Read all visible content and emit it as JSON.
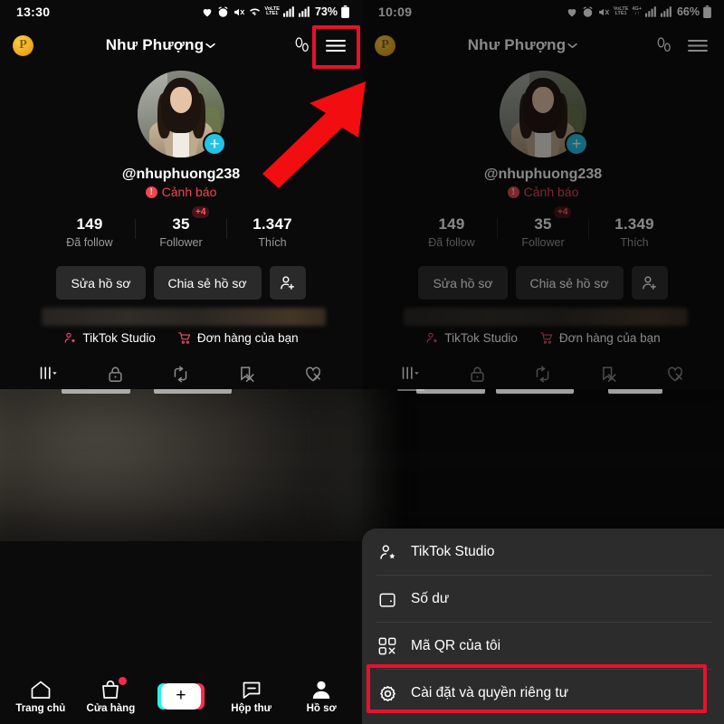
{
  "screens": [
    {
      "id": "left",
      "status_bar": {
        "clock": "13:30",
        "battery_percent": "73%",
        "network_label": "LTE1",
        "network_type": "VoLTE"
      },
      "top_bar": {
        "coin_label": "P",
        "title": "Như Phượng",
        "chevron_icon": "chevron-down-icon",
        "footprint_icon": "footprint-icon",
        "menu_icon": "hamburger-menu-icon"
      },
      "profile": {
        "handle": "@nhuphuong238",
        "warning_label": "Cảnh báo",
        "warning_icon": "exclamation-circle-icon",
        "add_badge_icon": "plus-icon"
      },
      "stats": [
        {
          "value": "149",
          "label": "Đã follow",
          "badge": ""
        },
        {
          "value": "35",
          "label": "Follower",
          "badge": "+4"
        },
        {
          "value": "1.347",
          "label": "Thích",
          "badge": ""
        }
      ],
      "actions": [
        {
          "label": "Sửa hồ sơ",
          "icon": ""
        },
        {
          "label": "Chia sẻ hồ sơ",
          "icon": ""
        },
        {
          "label": "",
          "icon": "add-person-icon"
        }
      ],
      "quick_links": [
        {
          "label": "TikTok Studio",
          "icon": "person-star-icon"
        },
        {
          "label": "Đơn hàng của bạn",
          "icon": "shopping-cart-icon"
        }
      ],
      "tabs": [
        {
          "icon": "grid-posts-icon",
          "active": true
        },
        {
          "icon": "lock-private-icon",
          "active": false
        },
        {
          "icon": "repost-icon",
          "active": false
        },
        {
          "icon": "bookmark-off-icon",
          "active": false
        },
        {
          "icon": "heart-off-icon",
          "active": false
        }
      ]
    },
    {
      "id": "right",
      "status_bar": {
        "clock": "10:09",
        "battery_percent": "66%",
        "network_label": "LTE1",
        "network_type": "VoLTE",
        "network_secondary": "4G+"
      },
      "top_bar": {
        "coin_label": "P",
        "title": "Như Phượng",
        "chevron_icon": "chevron-down-icon",
        "footprint_icon": "footprint-icon",
        "menu_icon": "hamburger-menu-icon"
      },
      "profile": {
        "handle": "@nhuphuong238",
        "warning_label": "Cảnh báo",
        "warning_icon": "exclamation-circle-icon",
        "add_badge_icon": "plus-icon"
      },
      "stats": [
        {
          "value": "149",
          "label": "Đã follow",
          "badge": ""
        },
        {
          "value": "35",
          "label": "Follower",
          "badge": "+4"
        },
        {
          "value": "1.349",
          "label": "Thích",
          "badge": ""
        }
      ],
      "actions": [
        {
          "label": "Sửa hồ sơ",
          "icon": ""
        },
        {
          "label": "Chia sẻ hồ sơ",
          "icon": ""
        },
        {
          "label": "",
          "icon": "add-person-icon"
        }
      ],
      "quick_links": [
        {
          "label": "TikTok Studio",
          "icon": "person-star-icon"
        },
        {
          "label": "Đơn hàng của bạn",
          "icon": "shopping-cart-icon"
        }
      ],
      "tabs": [
        {
          "icon": "grid-posts-icon",
          "active": true
        },
        {
          "icon": "lock-private-icon",
          "active": false
        },
        {
          "icon": "repost-icon",
          "active": false
        },
        {
          "icon": "bookmark-off-icon",
          "active": false
        },
        {
          "icon": "heart-off-icon",
          "active": false
        }
      ]
    }
  ],
  "menu_sheet": {
    "items": [
      {
        "label": "TikTok Studio",
        "icon": "person-star-icon",
        "highlighted": false
      },
      {
        "label": "Số dư",
        "icon": "wallet-icon",
        "highlighted": false
      },
      {
        "label": "Mã QR của tôi",
        "icon": "qr-code-icon",
        "highlighted": false
      },
      {
        "label": "Cài đặt và quyền riêng tư",
        "icon": "gear-icon",
        "highlighted": true
      }
    ]
  },
  "bottom_nav": [
    {
      "label": "Trang chủ",
      "icon": "home-icon",
      "badge": false
    },
    {
      "label": "Cửa hàng",
      "icon": "shop-bag-icon",
      "badge": true
    },
    {
      "label": "",
      "icon": "create-plus-icon",
      "badge": false
    },
    {
      "label": "Hộp thư",
      "icon": "inbox-message-icon",
      "badge": false
    },
    {
      "label": "Hồ sơ",
      "icon": "profile-person-icon",
      "badge": false
    }
  ],
  "annotations": {
    "highlight_color": "#e8112d",
    "arrow": {
      "name": "red-arrow-pointing-to-menu",
      "direction": "up-right"
    },
    "boxes": [
      {
        "name": "hamburger-menu-highlight",
        "target": "hamburger-menu-icon"
      },
      {
        "name": "settings-privacy-highlight",
        "target": "Cài đặt và quyền riêng tư"
      }
    ]
  }
}
